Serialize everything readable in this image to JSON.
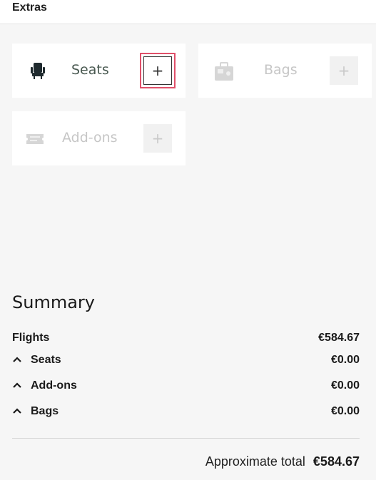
{
  "header": {
    "title": "Extras"
  },
  "extras": {
    "seats": {
      "label": "Seats",
      "add": "+"
    },
    "bags": {
      "label": "Bags",
      "add": "+"
    },
    "addons": {
      "label": "Add-ons",
      "add": "+"
    }
  },
  "summary": {
    "title": "Summary",
    "flights": {
      "label": "Flights",
      "value": "€584.67"
    },
    "seats": {
      "label": "Seats",
      "value": "€0.00"
    },
    "addons": {
      "label": "Add-ons",
      "value": "€0.00"
    },
    "bags": {
      "label": "Bags",
      "value": "€0.00"
    },
    "total_label": "Approximate total",
    "total_value": "€584.67"
  },
  "icons": {
    "seat": "seat-icon",
    "bag": "luggage-icon",
    "addons": "ticket-icon",
    "chevron": "chevron-up-icon"
  },
  "colors": {
    "active_text": "#4a5a52",
    "disabled_text": "#c6c6c6",
    "focus_ring": "#e0506a"
  }
}
